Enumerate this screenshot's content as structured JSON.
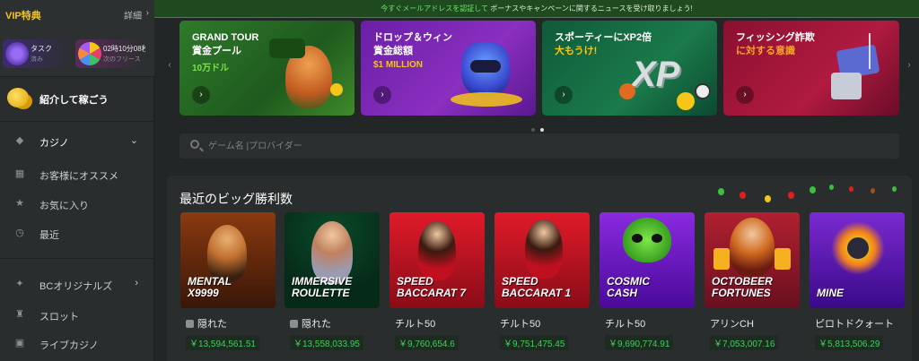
{
  "notice": {
    "link": "今すぐメールアドレスを認証して",
    "text": " ボーナスやキャンペーンに関するニュースを受け取りましょう!"
  },
  "sidebar": {
    "vip_title": "VIP特典",
    "vip_detail": "詳細",
    "vip_cards": [
      {
        "t1": "タスク",
        "t2": "済み"
      },
      {
        "t1": "02時10分08秒",
        "t2": "次のフリース"
      }
    ],
    "refer_label": "紹介して稼ごう",
    "casino_label": "カジノ",
    "items": [
      {
        "label": "お客様にオススメ"
      },
      {
        "label": "お気に入り"
      },
      {
        "label": "最近"
      },
      {
        "label": "BCオリジナルズ"
      },
      {
        "label": "スロット"
      },
      {
        "label": "ライブカジノ"
      }
    ]
  },
  "banners": [
    {
      "title": "GRAND TOUR",
      "sub": "賞金プール",
      "highlight": "10万ドル",
      "hl_color": "#7be04a"
    },
    {
      "title": "ドロップ＆ウィン",
      "sub": "賞金総額",
      "highlight": "$1 MILLION",
      "hl_color": "#f5c518"
    },
    {
      "title": "スポーティーにXP2倍",
      "sub": "",
      "highlight": "大もうけ!",
      "hl_color": "#f5c518"
    },
    {
      "title": "フィッシング詐欺",
      "sub": "に対する意識",
      "highlight": "",
      "hl_color": "#f5a623"
    }
  ],
  "search": {
    "placeholder": "ゲーム名 |プロバイダー"
  },
  "big_wins": {
    "title": "最近のビッグ勝利数",
    "games": [
      {
        "name": "MENTAL\nX9999",
        "user": "隠れた",
        "hidden": true,
        "amount": "￥13,594,561.51"
      },
      {
        "name": "IMMERSIVE\nROULETTE",
        "user": "隠れた",
        "hidden": true,
        "amount": "￥13,558,033.95"
      },
      {
        "name": "SPEED\nBACCARAT 7",
        "user": "チルト50",
        "hidden": false,
        "amount": "￥9,760,654.6"
      },
      {
        "name": "SPEED\nBACCARAT 1",
        "user": "チルト50",
        "hidden": false,
        "amount": "￥9,751,475.45"
      },
      {
        "name": "COSMIC\nCASH",
        "user": "チルト50",
        "hidden": false,
        "amount": "￥9,690,774.91"
      },
      {
        "name": "OCTOBEER\nFORTUNES",
        "user": "アリンCH",
        "hidden": false,
        "amount": "￥7,053,007.16"
      },
      {
        "name": "MINE",
        "user": "ピロトドクォート",
        "hidden": false,
        "amount": "￥5,813,506.29"
      }
    ]
  }
}
